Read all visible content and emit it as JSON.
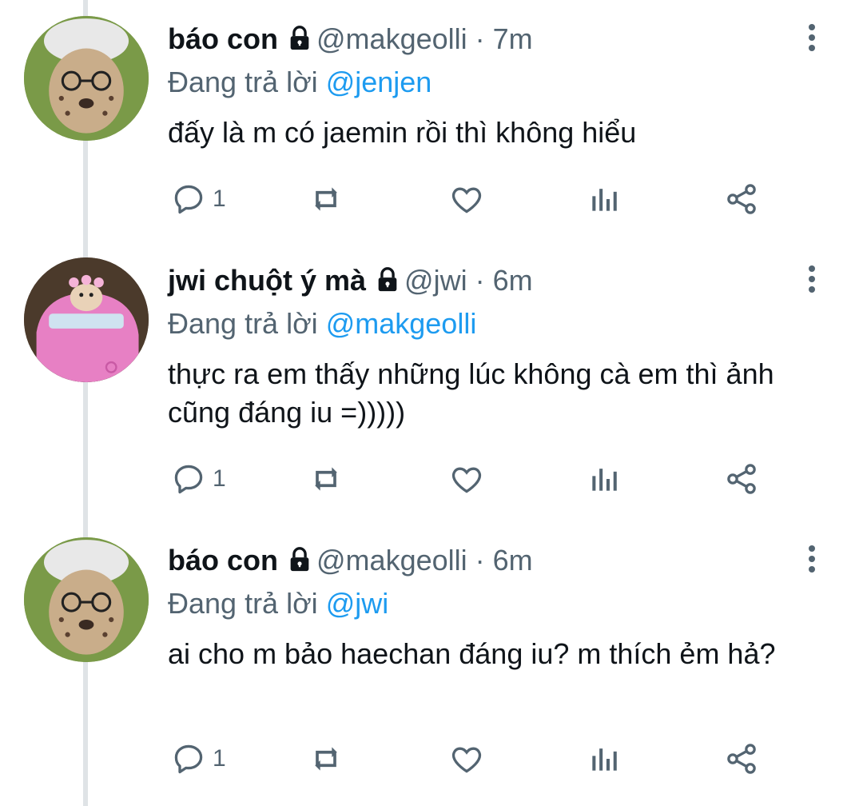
{
  "tweets": [
    {
      "name": "báo con",
      "handle": "@makgeolli",
      "time": "· 7m",
      "replying_prefix": "Đang trả lời",
      "replying_to": "@jenjen",
      "text": "đấy là m có jaemin rồi thì không hiểu",
      "reply_count": "1",
      "avatar_icon": "cheetah-avatar"
    },
    {
      "name": "jwi chuột ý mà",
      "handle": "@jwi",
      "time": "· 6m",
      "replying_prefix": "Đang trả lời",
      "replying_to": "@makgeolli",
      "text": "thực ra em thấy những lúc không cà em thì ảnh cũng đáng iu =)))))",
      "reply_count": "1",
      "avatar_icon": "hamster-avatar"
    },
    {
      "name": "báo con",
      "handle": "@makgeolli",
      "time": "· 6m",
      "replying_prefix": "Đang trả lời",
      "replying_to": "@jwi",
      "text": "ai cho m bảo haechan đáng iu? m thích ẻm hả?",
      "reply_count": "1",
      "avatar_icon": "cheetah-avatar"
    }
  ],
  "icons": [
    "lock-icon",
    "more-icon",
    "reply-icon",
    "retweet-icon",
    "like-icon",
    "views-icon",
    "share-icon"
  ],
  "colors": {
    "accent": "#1d9bf0",
    "secondary_text": "#536471",
    "text": "#0f1419"
  }
}
